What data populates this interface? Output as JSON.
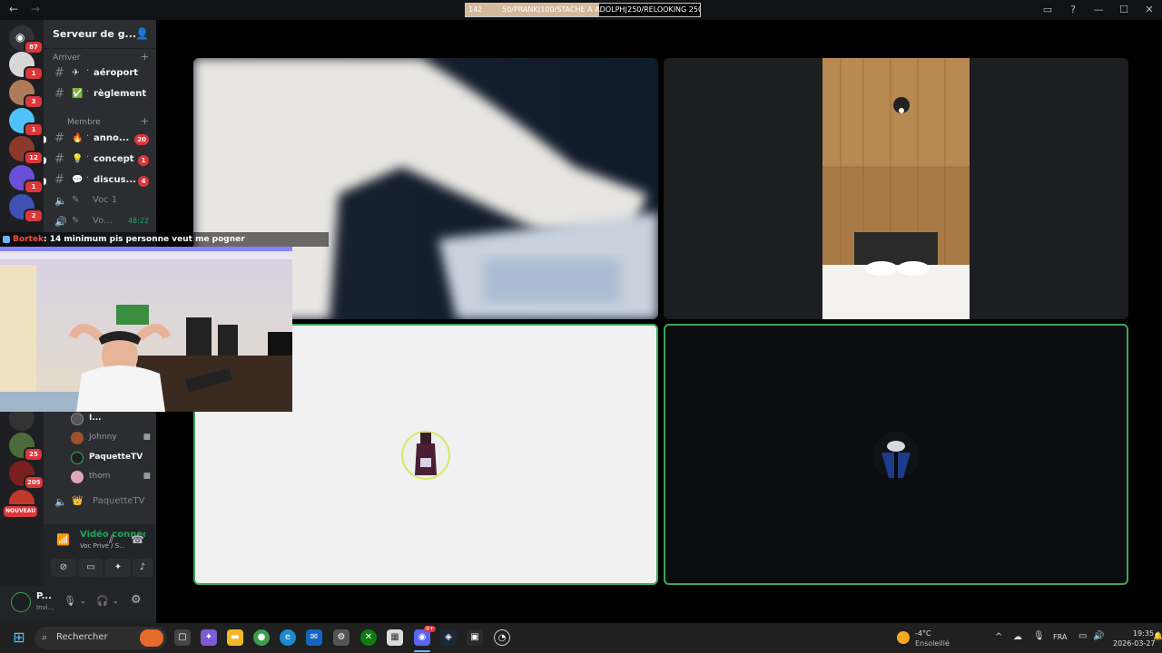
{
  "window": {
    "back_icon": "arrow-left-icon",
    "forward_icon": "arrow-right-icon",
    "ticker": {
      "left_text": "142",
      "text": "50/PRANK|100/STACHE À ADOLPH|250/RELOOKING 250",
      "progress": 0.57
    },
    "buttons": [
      "inbox-icon",
      "help-icon",
      "minimize-icon",
      "maximize-icon",
      "close-icon"
    ]
  },
  "servers": [
    {
      "name": "discord-home",
      "badge": "87",
      "color": "#313338"
    },
    {
      "name": "server-1",
      "badge": "1",
      "color": "#d7d7d7"
    },
    {
      "name": "server-2",
      "badge": "3",
      "color": "#b07a5a"
    },
    {
      "name": "server-3",
      "badge": "1",
      "color": "#4fc3f7"
    },
    {
      "name": "server-4",
      "badge": "12",
      "color": "#8b3a2a"
    },
    {
      "name": "server-5",
      "badge": "1",
      "color": "#6a4fd8"
    },
    {
      "name": "server-6",
      "badge": "2",
      "color": "#3f51b5"
    },
    {
      "name": "server-7",
      "badge": "",
      "color": "#333"
    },
    {
      "name": "server-8",
      "badge": "25",
      "color": "#4b6b3a"
    },
    {
      "name": "server-9",
      "badge": "205",
      "color": "#7a1f1f"
    },
    {
      "name": "server-10",
      "badge": "NOUVEAU",
      "color": "#c0392b"
    }
  ],
  "sidebar": {
    "server_name": "Serveur de g...",
    "categories": {
      "arriver": "Arriver",
      "membre": "Membre"
    },
    "channels_arriver": [
      {
        "emoji": "✈",
        "name": "aéroport"
      },
      {
        "emoji": "✅",
        "name": "règlement"
      }
    ],
    "channels_membre": [
      {
        "emoji": "🔥",
        "name": "anno...",
        "count": "20"
      },
      {
        "emoji": "💡",
        "name": "concept",
        "count": "1"
      },
      {
        "emoji": "💬",
        "name": "discus...",
        "count": "4"
      }
    ],
    "voice_channels": [
      {
        "name": "Voc 1",
        "time": ""
      },
      {
        "name": "Vo...",
        "time": "48:22"
      }
    ],
    "members": [
      {
        "name": "I...",
        "bold": true,
        "cam": false
      },
      {
        "name": "Johnny",
        "bold": false,
        "cam": true
      },
      {
        "name": "PaquetteTV",
        "bold": true,
        "cam": false
      },
      {
        "name": "thom",
        "bold": false,
        "cam": true
      }
    ],
    "voice_channel_bottom": "PaquetteTV",
    "voice_panel": {
      "status": "Vidéo connecté",
      "sub": "Voc Privé / S...",
      "buttons": [
        "camera-off-icon",
        "screen-share-icon",
        "activities-icon",
        "soundboard-icon"
      ]
    },
    "user_panel": {
      "name": "P...",
      "status": "Invi..."
    }
  },
  "overlay": {
    "chat_user": "Bortek",
    "chat_message": ": 14 minimum pis personne veut me pogner"
  },
  "taskbar": {
    "search_label": "Rechercher",
    "weather_temp": "-4°C",
    "weather_desc": "Ensoleillé",
    "language": "FRA",
    "time": "19:35",
    "date": "2026-03-27",
    "discord_badge": "9+"
  }
}
